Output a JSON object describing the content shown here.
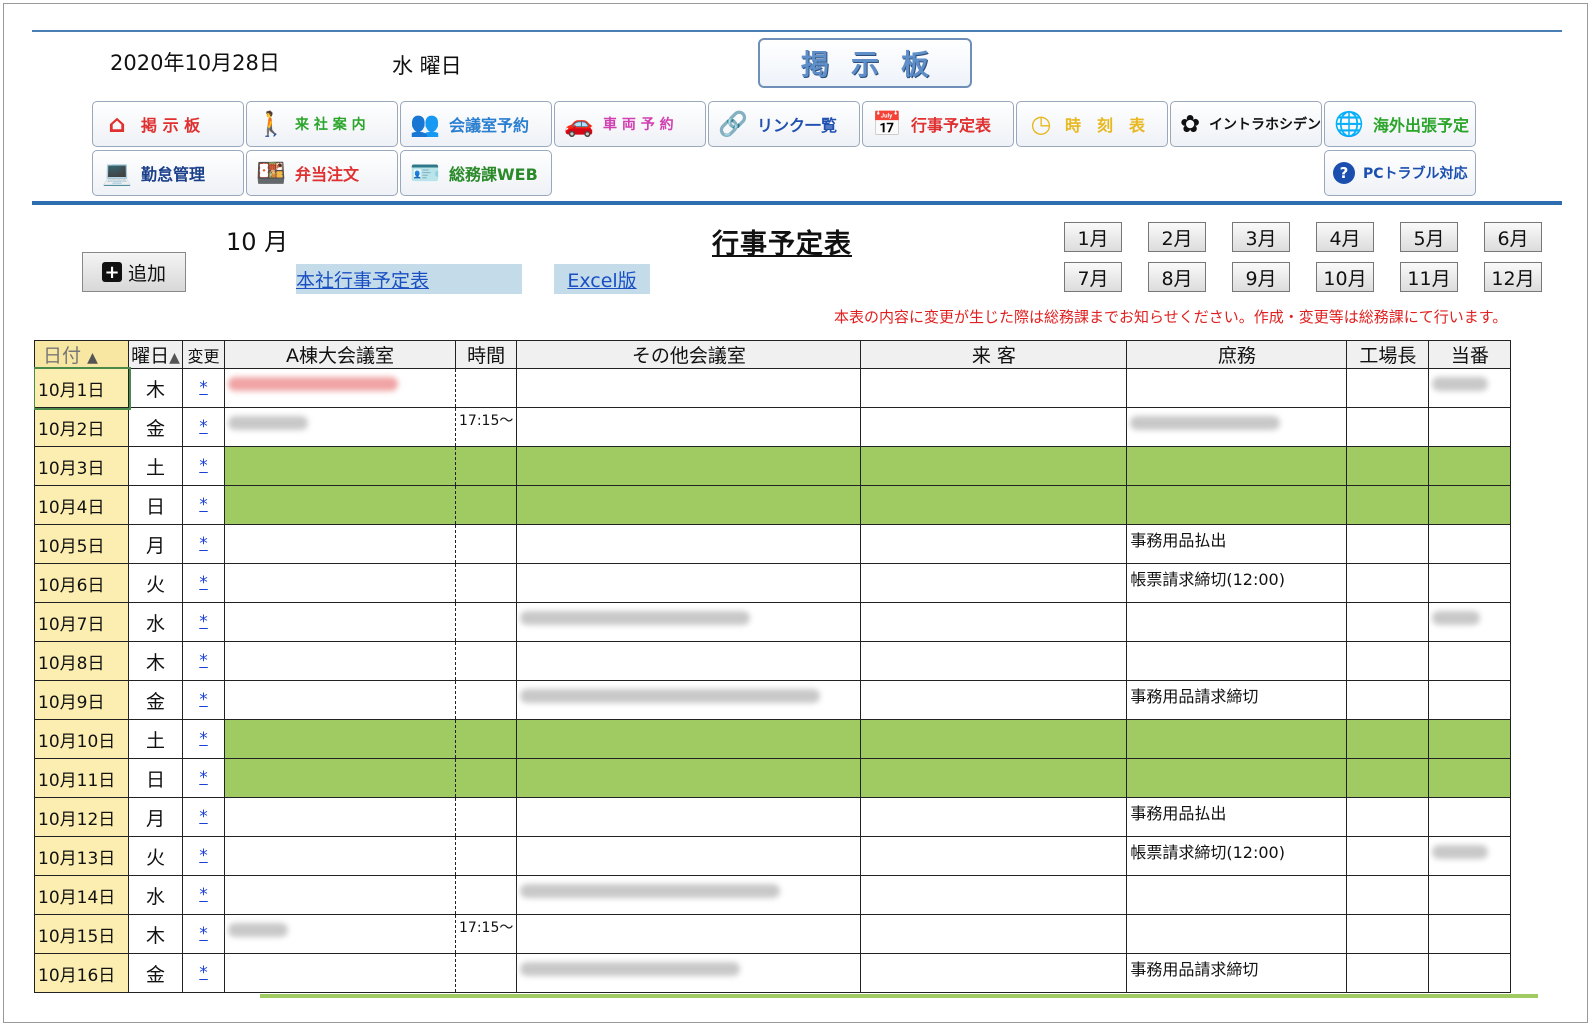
{
  "header": {
    "date": "2020年10月28日",
    "weekday": "水 曜日",
    "board_title": "掲示板"
  },
  "nav": {
    "row1": [
      {
        "label": "掲 示 板",
        "icon": "house-icon",
        "color": "#e03030"
      },
      {
        "label": "来 社 案 内",
        "icon": "walking-person-icon",
        "color": "#2aa52a"
      },
      {
        "label": "会議室予約",
        "icon": "meeting-people-icon",
        "color": "#2a7fd0"
      },
      {
        "label": "車 両 予 約",
        "icon": "car-icon",
        "color": "#d040b0"
      },
      {
        "label": "リンク一覧",
        "icon": "link-icon",
        "color": "#2050b0"
      },
      {
        "label": "行事予定表",
        "icon": "calendar-icon",
        "color": "#e03030"
      },
      {
        "label": "時　刻　表",
        "icon": "clock-icon",
        "color": "#e8b820"
      },
      {
        "label": "イントラホシデン",
        "icon": "gear-icon",
        "color": "#111111"
      },
      {
        "label": "海外出張予定",
        "icon": "globe-icon",
        "color": "#2aa52a"
      }
    ],
    "row2": [
      {
        "label": "勤怠管理",
        "icon": "worker-desk-icon",
        "color": "#1a3f8a"
      },
      {
        "label": "弁当注文",
        "icon": "lunchbox-icon",
        "color": "#e03030"
      },
      {
        "label": "総務課WEB",
        "icon": "id-card-icon",
        "color": "#2a8a2a"
      },
      {
        "label": "PCトラブル対応",
        "icon": "help-circle-icon",
        "color": "#1a4fb0"
      }
    ]
  },
  "toolbar": {
    "month_label": "10 月",
    "add_label": "追加",
    "link_main": "本社行事予定表",
    "link_excel": "Excel版",
    "page_title": "行事予定表",
    "months": [
      "1月",
      "2月",
      "3月",
      "4月",
      "5月",
      "6月",
      "7月",
      "8月",
      "9月",
      "10月",
      "11月",
      "12月"
    ],
    "notice": "本表の内容に変更が生じた際は総務課までお知らせください。作成・変更等は総務課にて行います。"
  },
  "table": {
    "headers": {
      "date": "日付",
      "weekday": "曜日",
      "change": "変更",
      "room_a": "A棟大会議室",
      "time": "時間",
      "other_room": "その他会議室",
      "visitors": "来 客",
      "general": "庶務",
      "factory_manager": "工場長",
      "duty": "当番"
    },
    "change_link": "*",
    "rows": [
      {
        "date": "10月1日",
        "weekday": "木",
        "weekend": false,
        "time": "",
        "general": ""
      },
      {
        "date": "10月2日",
        "weekday": "金",
        "weekend": false,
        "time": "17:15〜",
        "general": ""
      },
      {
        "date": "10月3日",
        "weekday": "土",
        "weekend": true,
        "time": "",
        "general": ""
      },
      {
        "date": "10月4日",
        "weekday": "日",
        "weekend": true,
        "time": "",
        "general": ""
      },
      {
        "date": "10月5日",
        "weekday": "月",
        "weekend": false,
        "time": "",
        "general": "事務用品払出"
      },
      {
        "date": "10月6日",
        "weekday": "火",
        "weekend": false,
        "time": "",
        "general": "帳票請求締切(12:00)"
      },
      {
        "date": "10月7日",
        "weekday": "水",
        "weekend": false,
        "time": "",
        "general": ""
      },
      {
        "date": "10月8日",
        "weekday": "木",
        "weekend": false,
        "time": "",
        "general": ""
      },
      {
        "date": "10月9日",
        "weekday": "金",
        "weekend": false,
        "time": "",
        "general": "事務用品請求締切"
      },
      {
        "date": "10月10日",
        "weekday": "土",
        "weekend": true,
        "time": "",
        "general": ""
      },
      {
        "date": "10月11日",
        "weekday": "日",
        "weekend": true,
        "time": "",
        "general": ""
      },
      {
        "date": "10月12日",
        "weekday": "月",
        "weekend": false,
        "time": "",
        "general": "事務用品払出"
      },
      {
        "date": "10月13日",
        "weekday": "火",
        "weekend": false,
        "time": "",
        "general": "帳票請求締切(12:00)"
      },
      {
        "date": "10月14日",
        "weekday": "水",
        "weekend": false,
        "time": "",
        "general": ""
      },
      {
        "date": "10月15日",
        "weekday": "木",
        "weekend": false,
        "time": "17:15〜",
        "general": ""
      },
      {
        "date": "10月16日",
        "weekday": "金",
        "weekend": false,
        "time": "",
        "general": "事務用品請求締切"
      }
    ]
  },
  "colors": {
    "accent_blue": "#2e6db0",
    "weekend_green": "#9fcb62",
    "date_yellow": "#fbeeb0",
    "notice_red": "#e02020",
    "link_blue": "#1a4fc4"
  }
}
